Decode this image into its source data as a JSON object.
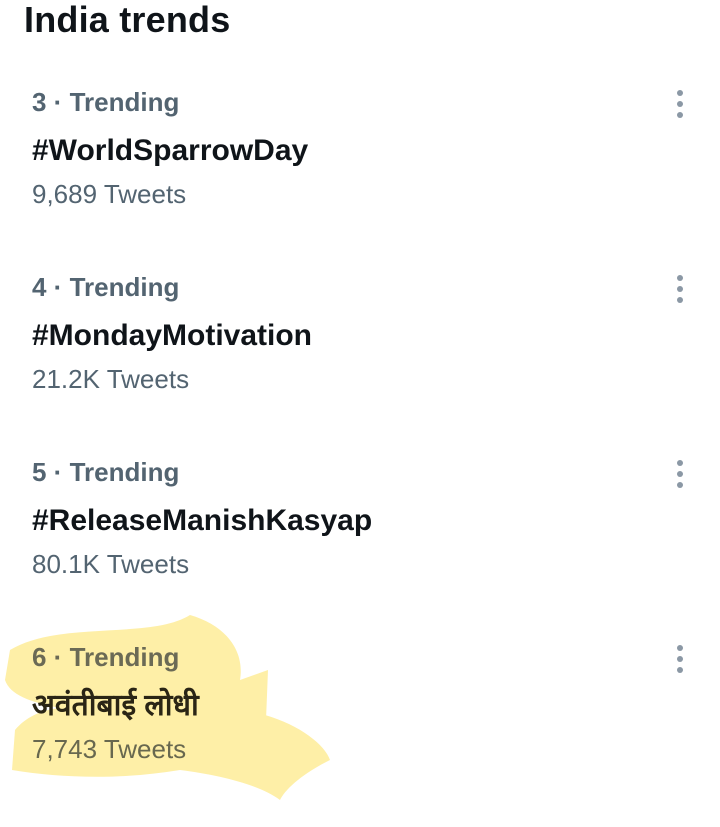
{
  "header": {
    "title": "India trends"
  },
  "trends": [
    {
      "meta": "3 · Trending",
      "name": "#WorldSparrowDay",
      "count": "9,689 Tweets"
    },
    {
      "meta": "4 · Trending",
      "name": "#MondayMotivation",
      "count": "21.2K Tweets"
    },
    {
      "meta": "5 · Trending",
      "name": "#ReleaseManishKasyap",
      "count": "80.1K Tweets"
    },
    {
      "meta": "6 · Trending",
      "name": "अवंतीबाई लोधी",
      "count": "7,743 Tweets"
    }
  ],
  "icons": {
    "more": "more-vertical-icon"
  },
  "colors": {
    "primary_text": "#0f1419",
    "secondary_text": "#536471",
    "highlight": "#fde98a"
  }
}
